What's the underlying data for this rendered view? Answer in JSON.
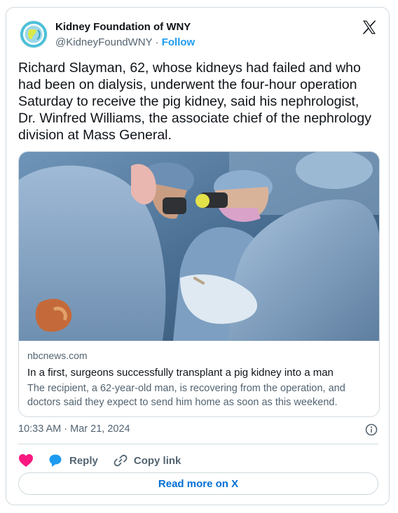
{
  "author": {
    "name": "Kidney Foundation of WNY",
    "handle": "@KidneyFoundWNY",
    "separator": "·",
    "follow_label": "Follow"
  },
  "tweet": {
    "text": "Richard Slayman, 62, whose kidneys had failed and who had been on dialysis, underwent the four-hour operation Saturday to receive the pig kidney, said his nephrologist, Dr. Winfred Williams, the associate chief of the nephrology division at Mass General."
  },
  "link_card": {
    "domain": "nbcnews.com",
    "headline": "In a first, surgeons successfully transplant a pig kidney into a man",
    "description": "The recipient, a 62-year-old man, is recovering from the operation, and doctors said they expect to send him home as soon as this weekend."
  },
  "timestamp": "10:33 AM · Mar 21, 2024",
  "actions": {
    "reply_label": "Reply",
    "copy_link_label": "Copy link"
  },
  "read_more_label": "Read more on X",
  "colors": {
    "accent": "#1d9bf0",
    "like": "#f91880",
    "text": "#0f1419",
    "muted": "#536471",
    "border": "#cfd9de"
  }
}
